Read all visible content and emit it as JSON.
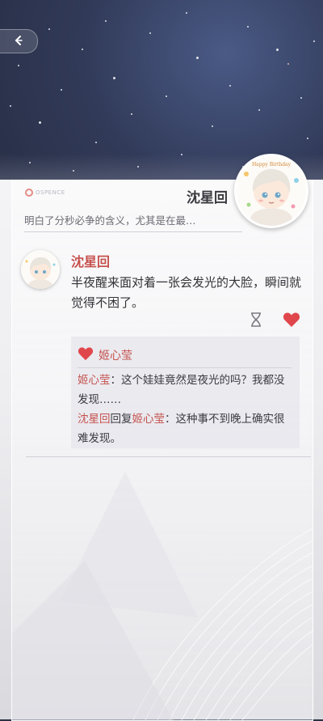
{
  "header": {
    "title": "沈星回",
    "summary": "明白了分秒必争的含义，尤其是在最…",
    "logo_text": "OSPENCE"
  },
  "profile": {
    "name": "沈星回",
    "avatar_banner": "Happy Birthday"
  },
  "post": {
    "author": "沈星回",
    "text": "半夜醒来面对着一张会发光的大脸，瞬间就觉得不困了。",
    "liked": true
  },
  "likes": {
    "names": [
      "姬心莹"
    ]
  },
  "comments": [
    {
      "author": "姬心莹",
      "separator": "：",
      "text": "这个娃娃竟然是夜光的吗？我都没发现……"
    },
    {
      "author": "沈星回",
      "reply_word": "回复",
      "reply_to": "姬心莹",
      "separator": "：",
      "text": "这种事不到晚上确实很难发现。"
    }
  ],
  "icons": {
    "back": "chevron-left-icon",
    "timer": "hourglass-icon",
    "like": "heart-icon"
  },
  "colors": {
    "accent": "#c6524e",
    "heart": "#e0474c",
    "text": "#333338"
  }
}
